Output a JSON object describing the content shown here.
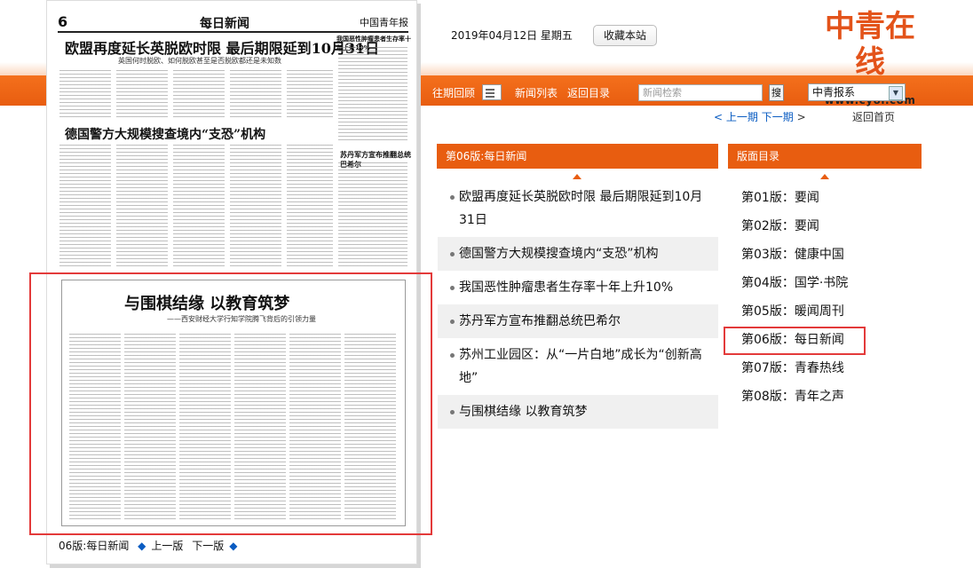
{
  "header": {
    "date": "2019年04月12日 星期五",
    "favorite_label": "收藏本站",
    "logo_cn": "中青在线",
    "logo_en": "www.cyol.com"
  },
  "nav": {
    "history_label": "往期回顾",
    "news_list_label": "新闻列表",
    "back_dir_label": "返回目录",
    "search_placeholder": "新闻检索",
    "search_button": "搜",
    "paper_select": "中青报系",
    "prev_issue": "上一期",
    "next_issue": "下一期",
    "back_home": "返回首页"
  },
  "paper": {
    "page_no": "6",
    "page_name": "每日新闻",
    "masthead": "中国青年报",
    "headline1": "欧盟再度延长英脱欧时限 最后期限延到10月31日",
    "headline1_sub": "英国何时脱欧、如何脱欧甚至是否脱欧都还是未知数",
    "side_headline": "我国恶性肿瘤患者生存率十年上升10%",
    "headline2": "德国警方大规模搜查境内“支恐”机构",
    "side_headline2": "苏丹军方宣布推翻总统巴希尔",
    "headline3": "与围棋结缘 以教育筑梦",
    "headline3_sub": "——西安财经大学行知学院腾飞背后的引领力量"
  },
  "pager": {
    "current": "06版:每日新闻",
    "prev": "上一版",
    "next": "下一版"
  },
  "news_panel": {
    "title": "第06版:每日新闻",
    "items": [
      "欧盟再度延长英脱欧时限 最后期限延到10月31日",
      "德国警方大规模搜查境内“支恐”机构",
      "我国恶性肿瘤患者生存率十年上升10%",
      "苏丹军方宣布推翻总统巴希尔",
      "苏州工业园区：从“一片白地”成长为“创新高地”",
      "与围棋结缘 以教育筑梦"
    ]
  },
  "dir_panel": {
    "title": "版面目录",
    "items": [
      "第01版：要闻",
      "第02版：要闻",
      "第03版：健康中国",
      "第04版：国学·书院",
      "第05版：暖闻周刊",
      "第06版：每日新闻",
      "第07版：青春热线",
      "第08版：青年之声"
    ],
    "selected_index": 5
  },
  "colors": {
    "accent": "#e85d10",
    "link": "#0a5cc2",
    "highlight": "#e33a3a"
  }
}
